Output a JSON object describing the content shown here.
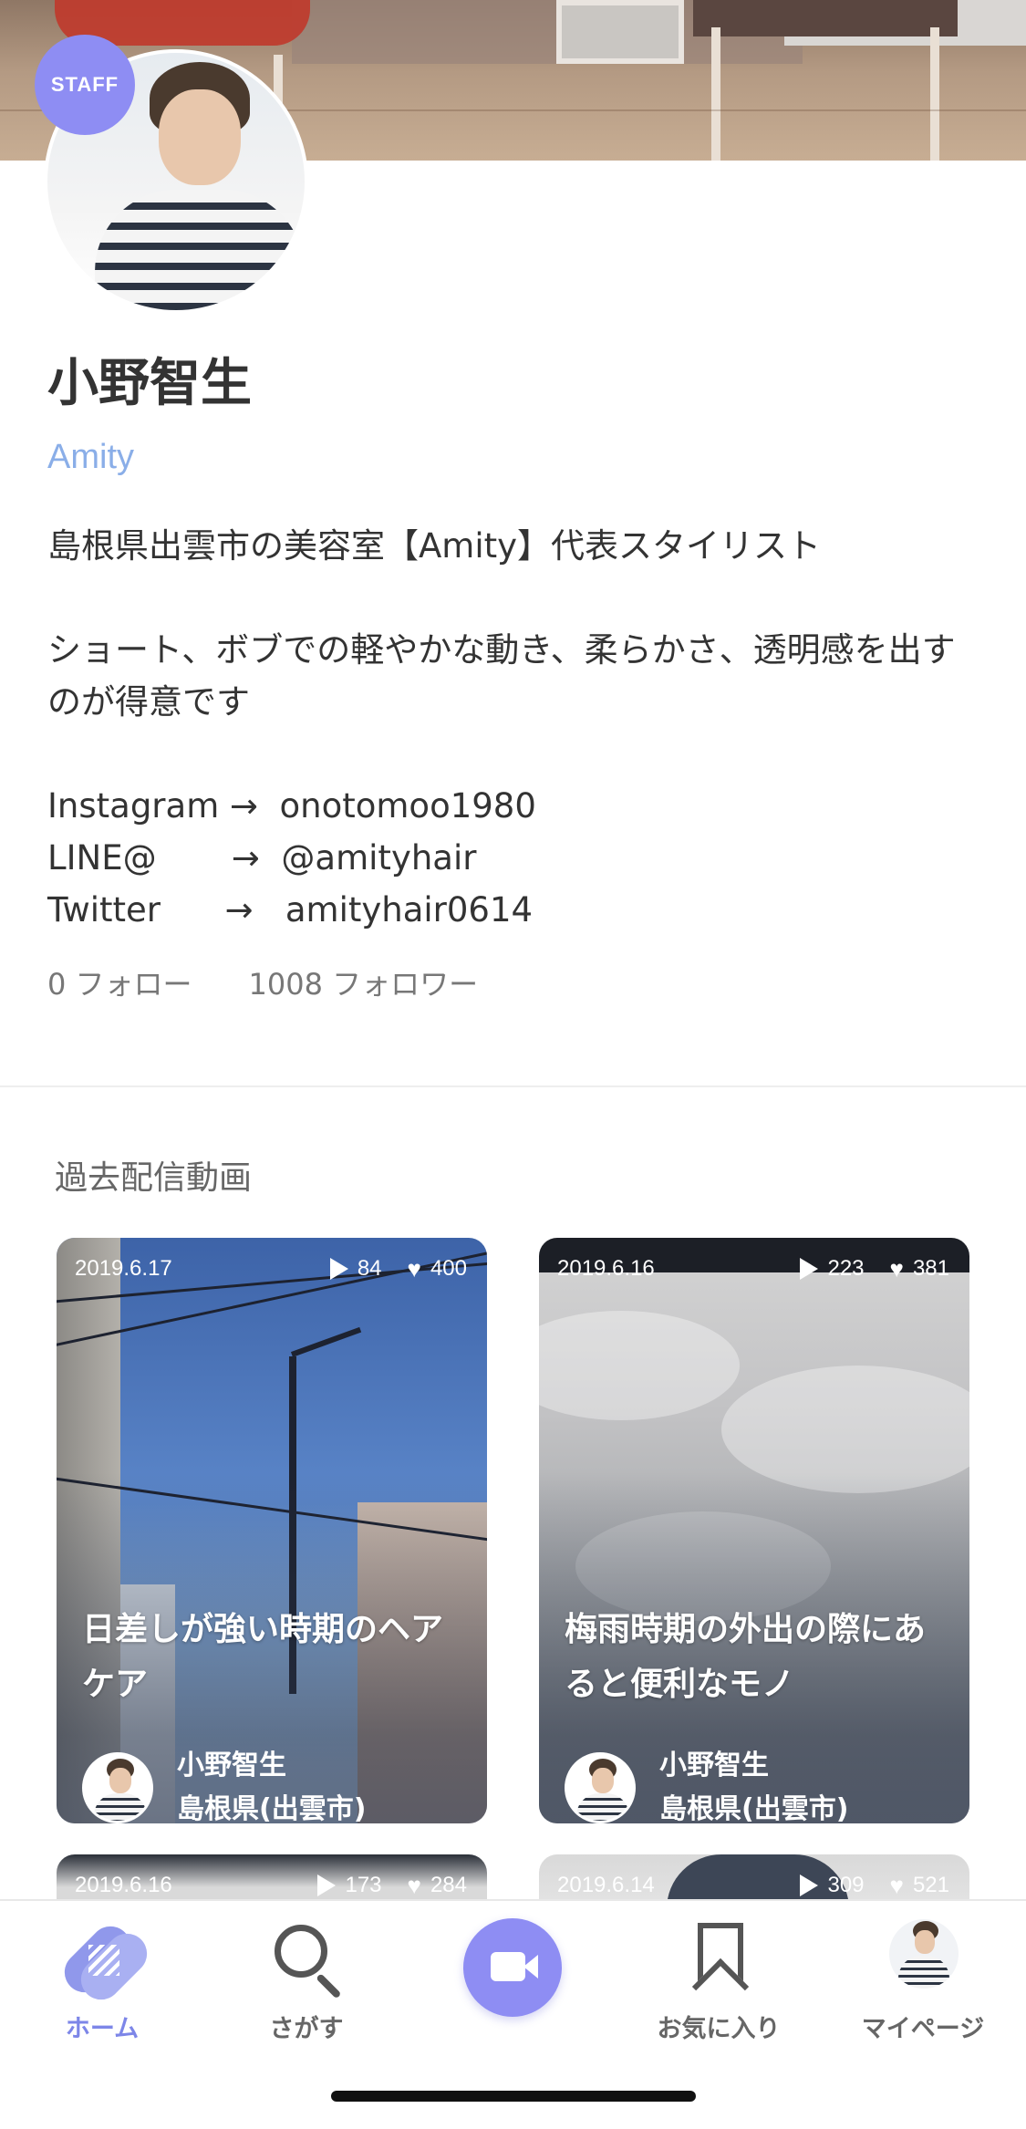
{
  "profile": {
    "badge": "STAFF",
    "name": "小野智生",
    "salon": "Amity",
    "bio": "島根県出雲市の美容室【Amity】代表スタイリスト\n\nショート、ボブでの軽やかな動き、柔らかさ、透明感を出すのが得意です\n\nInstagram →  onotomoo1980\nLINE@       →  @amityhair\nTwitter      →   amityhair0614",
    "following": "0 フォロー",
    "followers": "1008 フォロワー"
  },
  "videos_section": {
    "title": "過去配信動画",
    "cards": [
      {
        "date": "2019.6.17",
        "views": "84",
        "likes": "400",
        "title": "日差しが強い時期のヘアケア",
        "author": "小野智生",
        "location": "島根県(出雲市)"
      },
      {
        "date": "2019.6.16",
        "views": "223",
        "likes": "381",
        "title": "梅雨時期の外出の際にあると便利なモノ",
        "author": "小野智生",
        "location": "島根県(出雲市)"
      },
      {
        "date": "2019.6.16",
        "views": "173",
        "likes": "284"
      },
      {
        "date": "2019.6.14",
        "views": "309",
        "likes": "521"
      }
    ]
  },
  "bottom_nav": {
    "items": [
      {
        "label": "ホーム",
        "icon": "home-logo-icon",
        "active": true
      },
      {
        "label": "さがす",
        "icon": "search-icon"
      },
      {
        "label": "",
        "icon": "video-camera-icon"
      },
      {
        "label": "お気に入り",
        "icon": "bookmark-icon"
      },
      {
        "label": "マイページ",
        "icon": "avatar-icon"
      }
    ]
  },
  "colors": {
    "accent": "#8e8df3",
    "link": "#8aaee8",
    "nav_active": "#7d86e8"
  }
}
